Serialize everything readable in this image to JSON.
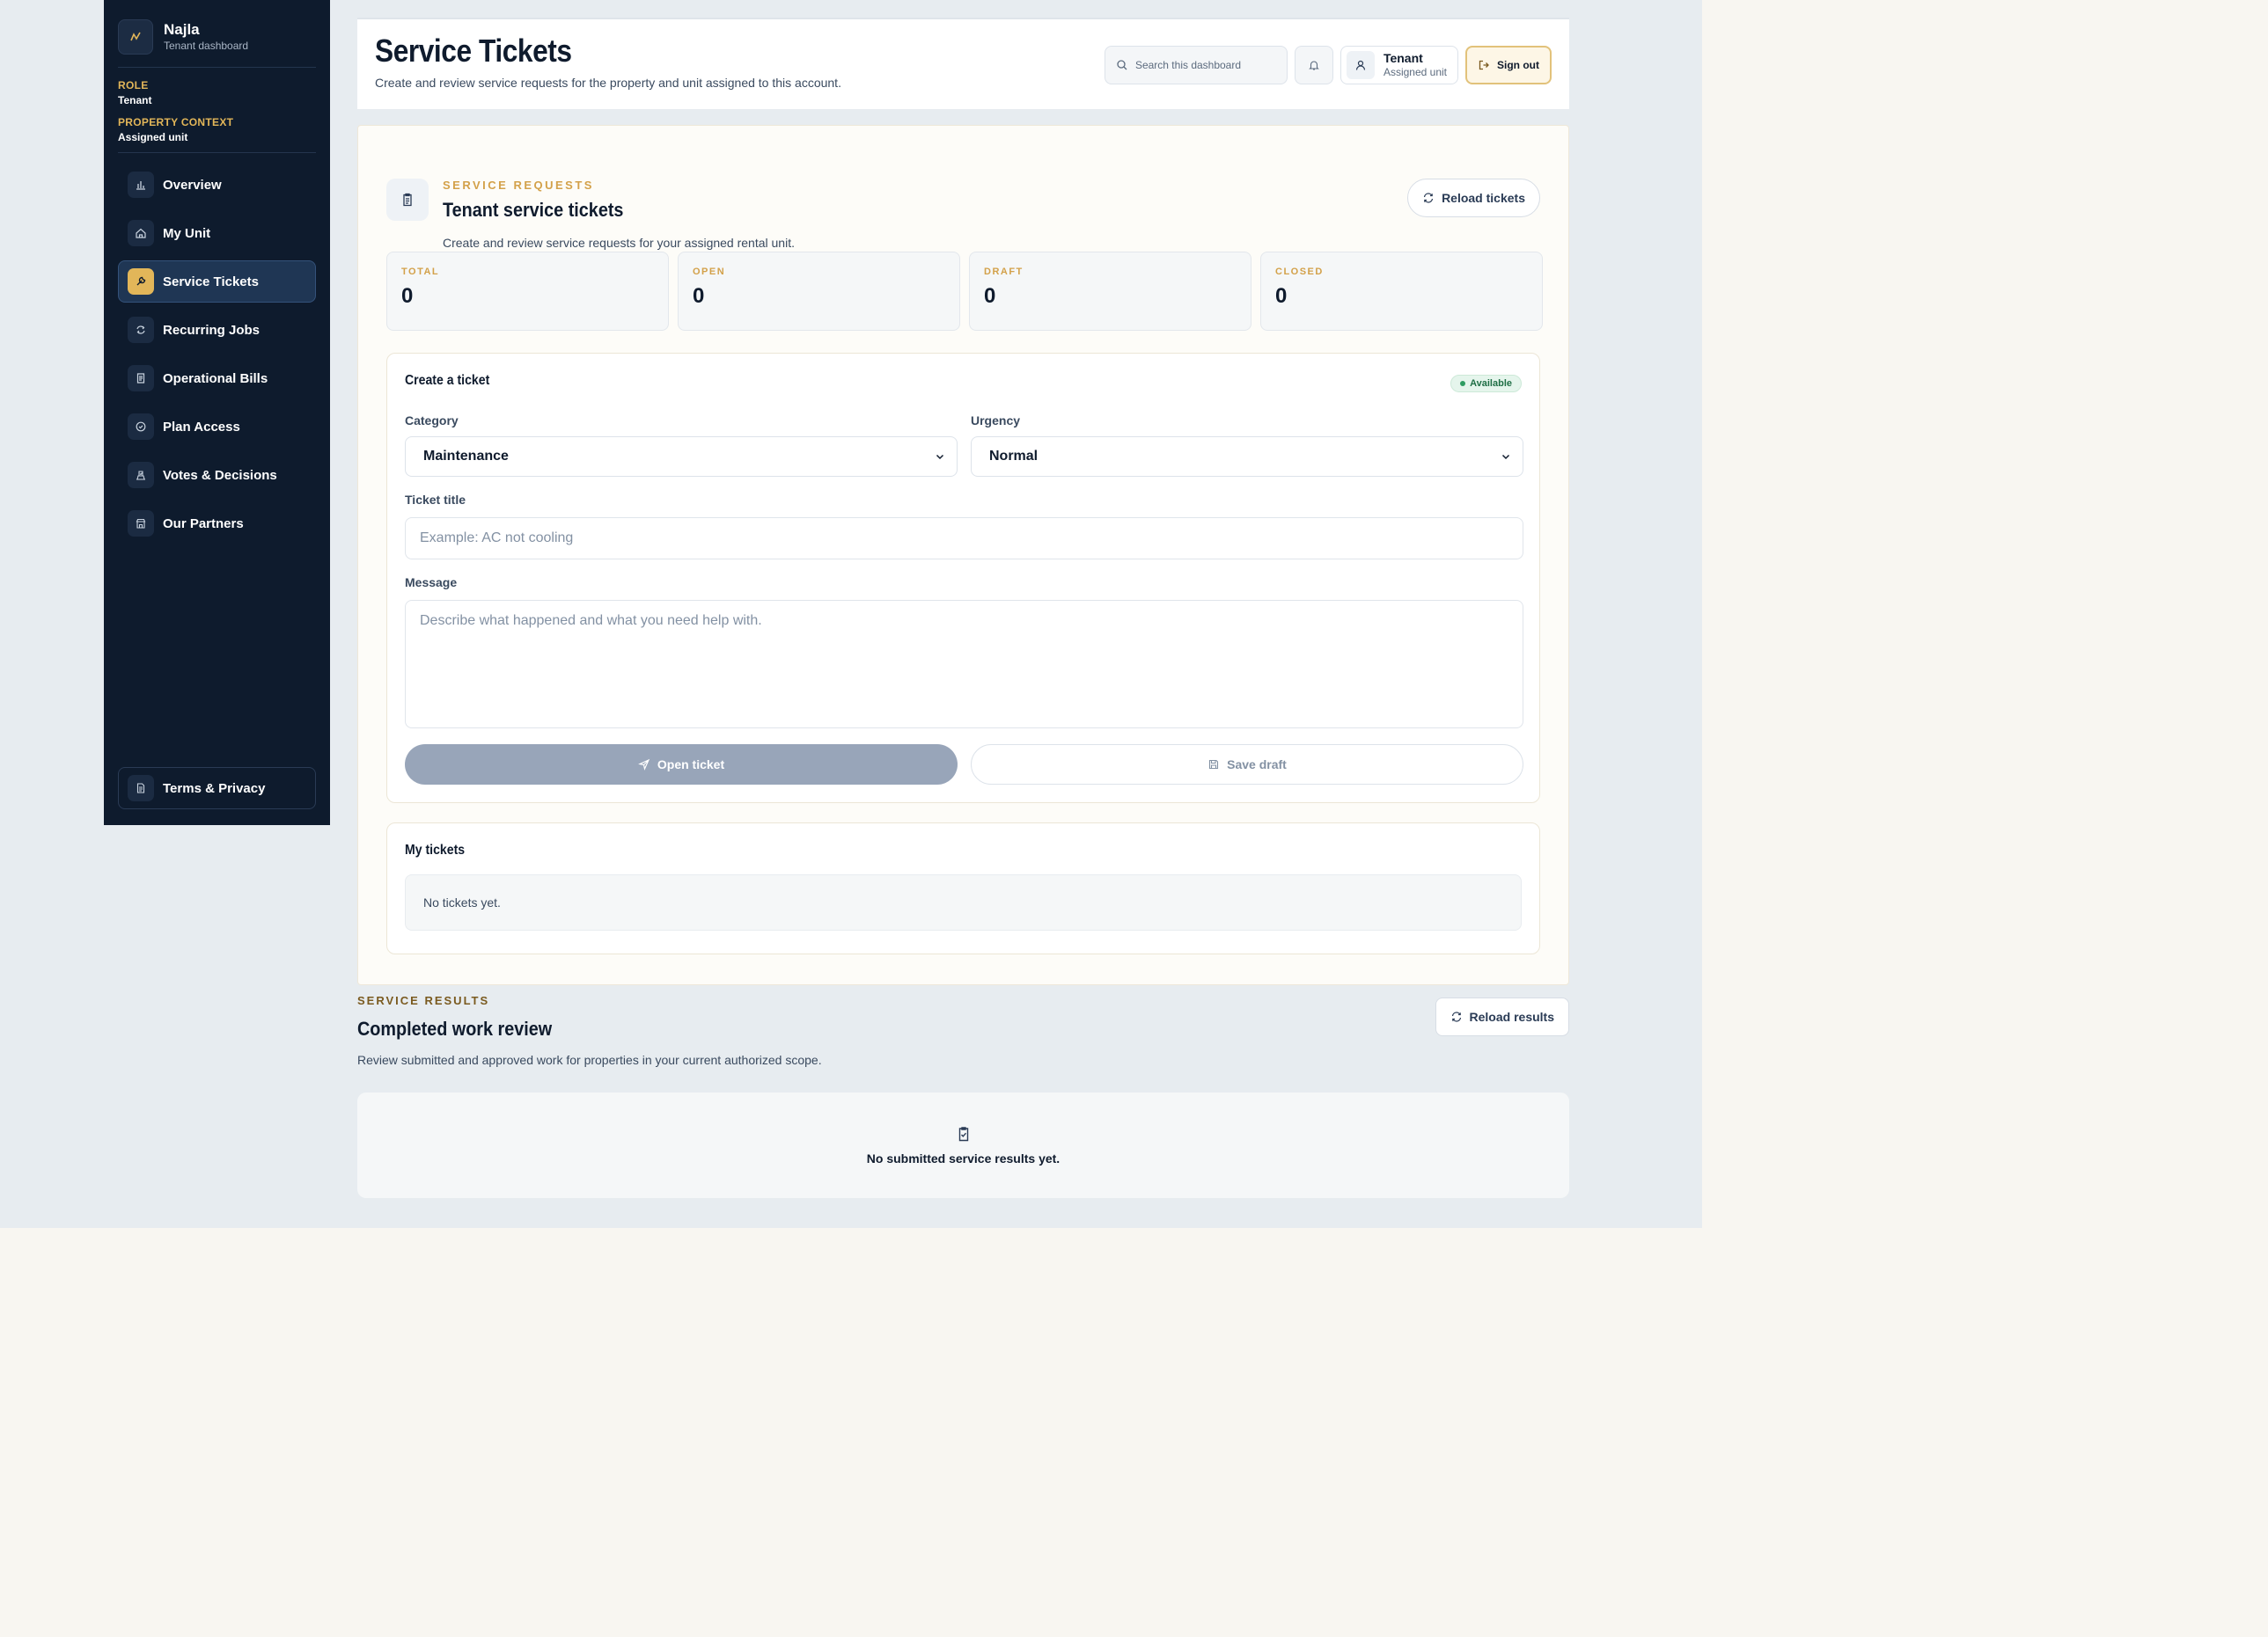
{
  "sidebar": {
    "brand_name": "Najla",
    "brand_sub": "Tenant dashboard",
    "role_label": "ROLE",
    "role_value": "Tenant",
    "context_label": "PROPERTY CONTEXT",
    "context_value": "Assigned unit",
    "items": [
      {
        "label": "Overview",
        "icon": "bar-chart-icon"
      },
      {
        "label": "My Unit",
        "icon": "home-icon"
      },
      {
        "label": "Service Tickets",
        "icon": "wrench-icon",
        "active": true
      },
      {
        "label": "Recurring Jobs",
        "icon": "repeat-icon"
      },
      {
        "label": "Operational Bills",
        "icon": "receipt-icon"
      },
      {
        "label": "Plan Access",
        "icon": "check-circle-icon"
      },
      {
        "label": "Votes & Decisions",
        "icon": "ballot-icon"
      },
      {
        "label": "Our Partners",
        "icon": "store-icon"
      }
    ],
    "terms_label": "Terms & Privacy"
  },
  "header": {
    "title": "Service Tickets",
    "subtitle": "Create and review service requests for the property and unit assigned to this account.",
    "search_placeholder": "Search this dashboard",
    "user_name": "Tenant",
    "user_sub": "Assigned unit",
    "signout_label": "Sign out"
  },
  "service_requests": {
    "eyebrow": "SERVICE REQUESTS",
    "title": "Tenant service tickets",
    "subtitle": "Create and review service requests for your assigned rental unit.",
    "reload_label": "Reload tickets",
    "stats": [
      {
        "label": "TOTAL",
        "value": "0"
      },
      {
        "label": "OPEN",
        "value": "0"
      },
      {
        "label": "DRAFT",
        "value": "0"
      },
      {
        "label": "CLOSED",
        "value": "0"
      }
    ]
  },
  "create_ticket": {
    "title": "Create a ticket",
    "badge": "Available",
    "category_label": "Category",
    "category_value": "Maintenance",
    "urgency_label": "Urgency",
    "urgency_value": "Normal",
    "title_label": "Ticket title",
    "title_placeholder": "Example: AC not cooling",
    "message_label": "Message",
    "message_placeholder": "Describe what happened and what you need help with.",
    "open_label": "Open ticket",
    "draft_label": "Save draft"
  },
  "my_tickets": {
    "title": "My tickets",
    "empty": "No tickets yet."
  },
  "service_results": {
    "eyebrow": "SERVICE RESULTS",
    "title": "Completed work review",
    "subtitle": "Review submitted and approved work for properties in your current authorized scope.",
    "reload_label": "Reload results",
    "empty": "No submitted service results yet."
  },
  "colors": {
    "sidebar_bg": "#0e1b2d",
    "accent_gold": "#e2b659",
    "page_bg": "#e7ecf0",
    "available_green": "#2e9c62"
  }
}
